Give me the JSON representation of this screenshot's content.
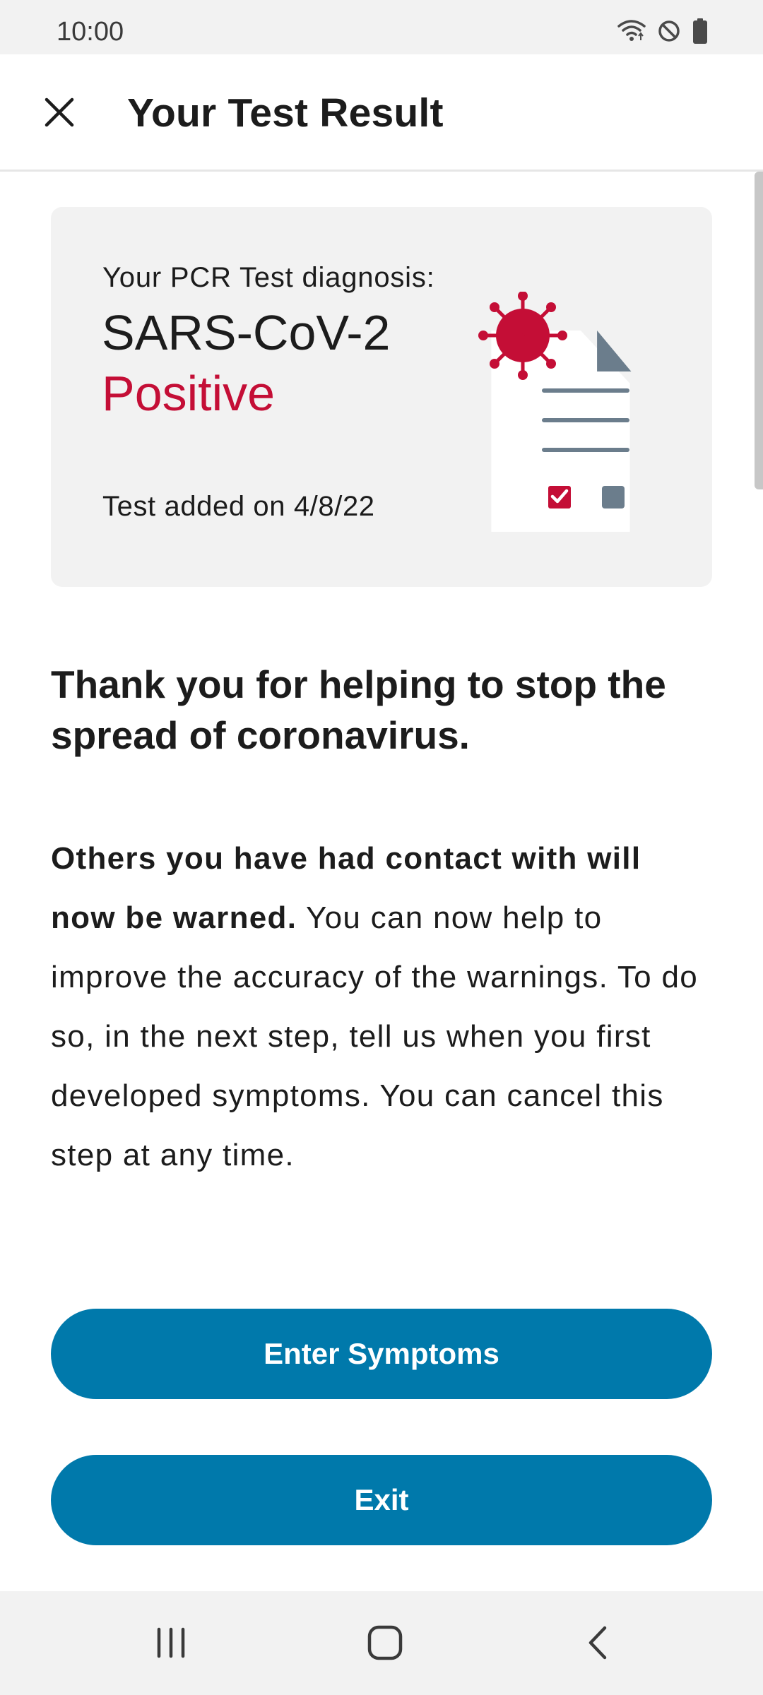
{
  "status_bar": {
    "time": "10:00",
    "icons": [
      "wifi-icon",
      "do-not-disturb-icon",
      "battery-icon"
    ]
  },
  "app_bar": {
    "close_icon": "close-icon",
    "title": "Your Test Result"
  },
  "result_card": {
    "label": "Your PCR Test diagnosis:",
    "pathogen": "SARS-CoV-2",
    "result": "Positive",
    "date_text": "Test added on 4/8/22",
    "illustration_icons": [
      "virus-icon",
      "document-icon",
      "checkbox-checked-icon",
      "checkbox-empty-icon"
    ]
  },
  "content": {
    "headline": "Thank you for helping to stop the spread of coronavirus.",
    "body_bold": "Others you have had contact with will now be warned.",
    "body_rest": " You can now help to improve the accuracy of the warnings. To do so, in the next step, tell us when you first developed symptoms. You can cancel this step at any time."
  },
  "buttons": {
    "enter_symptoms": "Enter Symptoms",
    "exit": "Exit"
  },
  "nav_bar": {
    "icons": [
      "recent-apps-icon",
      "home-icon",
      "back-icon"
    ]
  },
  "colors": {
    "accent": "#0079ab",
    "positive_red": "#c40e36",
    "card_background": "#f2f2f2",
    "icon_gray": "#6b7d8c"
  }
}
